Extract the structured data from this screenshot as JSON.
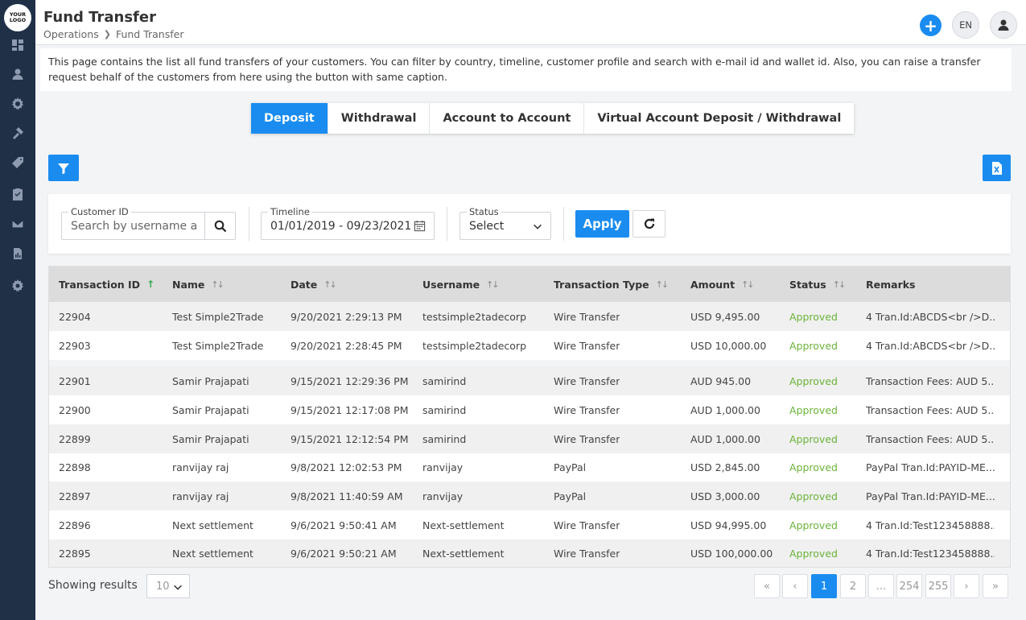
{
  "app": {
    "logo_text": "YOUR LOGO"
  },
  "sidebar": {
    "items": [
      {
        "icon": "dashboard-icon"
      },
      {
        "icon": "user-icon"
      },
      {
        "icon": "settings-gear-icon"
      },
      {
        "icon": "tools-icon"
      },
      {
        "icon": "tag-icon"
      },
      {
        "icon": "clipboard-check-icon"
      },
      {
        "icon": "mail-icon"
      },
      {
        "icon": "report-icon"
      },
      {
        "icon": "cog-icon"
      }
    ]
  },
  "header": {
    "title": "Fund Transfer",
    "breadcrumb": [
      "Operations",
      "Fund Transfer"
    ],
    "lang": "EN"
  },
  "description": "This page contains the list all fund transfers of your customers. You can filter by country, timeline, customer profile and search with e-mail id and wallet id. Also, you can raise a transfer request behalf of the customers from here using the button with same caption.",
  "tabs": [
    {
      "label": "Deposit",
      "active": true
    },
    {
      "label": "Withdrawal",
      "active": false
    },
    {
      "label": "Account to Account",
      "active": false
    },
    {
      "label": "Virtual Account Deposit / Withdrawal",
      "active": false
    }
  ],
  "filters": {
    "customer_id": {
      "label": "Customer ID",
      "placeholder": "Search by username and"
    },
    "timeline": {
      "label": "Timeline",
      "value": "01/01/2019 - 09/23/2021"
    },
    "status": {
      "label": "Status",
      "value": "Select"
    },
    "apply_label": "Apply"
  },
  "table": {
    "columns": [
      "Transaction ID",
      "Name",
      "Date",
      "Username",
      "Transaction Type",
      "Amount",
      "Status",
      "Remarks"
    ],
    "rows": [
      {
        "id": "22904",
        "name": "Test Simple2Trade",
        "date": "9/20/2021 2:29:13 PM",
        "username": "testsimple2tadecorp",
        "type": "Wire Transfer",
        "amount": "USD 9,495.00",
        "status": "Approved",
        "remarks": "4 Tran.Id:ABCDS<br />D..."
      },
      {
        "id": "22903",
        "name": "Test Simple2Trade",
        "date": "9/20/2021 2:28:45 PM",
        "username": "testsimple2tadecorp",
        "type": "Wire Transfer",
        "amount": "USD 10,000.00",
        "status": "Approved",
        "remarks": "4 Tran.Id:ABCDS<br />D..."
      },
      {
        "id": "22901",
        "name": "Samir Prajapati",
        "date": "9/15/2021 12:29:36 PM",
        "username": "samirind",
        "type": "Wire Transfer",
        "amount": "AUD 945.00",
        "status": "Approved",
        "remarks": "Transaction Fees: AUD 5..."
      },
      {
        "id": "22900",
        "name": "Samir Prajapati",
        "date": "9/15/2021 12:17:08 PM",
        "username": "samirind",
        "type": "Wire Transfer",
        "amount": "AUD 1,000.00",
        "status": "Approved",
        "remarks": "Transaction Fees: AUD 5..."
      },
      {
        "id": "22899",
        "name": "Samir Prajapati",
        "date": "9/15/2021 12:12:54 PM",
        "username": "samirind",
        "type": "Wire Transfer",
        "amount": "AUD 1,000.00",
        "status": "Approved",
        "remarks": "Transaction Fees: AUD 5..."
      },
      {
        "id": "22898",
        "name": "ranvijay raj",
        "date": "9/8/2021 12:02:53 PM",
        "username": "ranvijay",
        "type": "PayPal",
        "amount": "USD 2,845.00",
        "status": "Approved",
        "remarks": "PayPal Tran.Id:PAYID-ME..."
      },
      {
        "id": "22897",
        "name": "ranvijay raj",
        "date": "9/8/2021 11:40:59 AM",
        "username": "ranvijay",
        "type": "PayPal",
        "amount": "USD 3,000.00",
        "status": "Approved",
        "remarks": "PayPal Tran.Id:PAYID-ME..."
      },
      {
        "id": "22896",
        "name": "Next settlement",
        "date": "9/6/2021 9:50:41 AM",
        "username": "Next-settlement",
        "type": "Wire Transfer",
        "amount": "USD 94,995.00",
        "status": "Approved",
        "remarks": "4 Tran.Id:Test123458888..."
      },
      {
        "id": "22895",
        "name": "Next settlement",
        "date": "9/6/2021 9:50:21 AM",
        "username": "Next-settlement",
        "type": "Wire Transfer",
        "amount": "USD 100,000.00",
        "status": "Approved",
        "remarks": "4 Tran.Id:Test123458888..."
      }
    ]
  },
  "footer": {
    "showing_label": "Showing results",
    "page_size": "10",
    "pages": [
      "1",
      "2",
      "...",
      "254",
      "255"
    ],
    "current_page": "1"
  },
  "colors": {
    "accent": "#1a8cf0",
    "sidebar": "#1f3047",
    "approved": "#6bb33a"
  }
}
